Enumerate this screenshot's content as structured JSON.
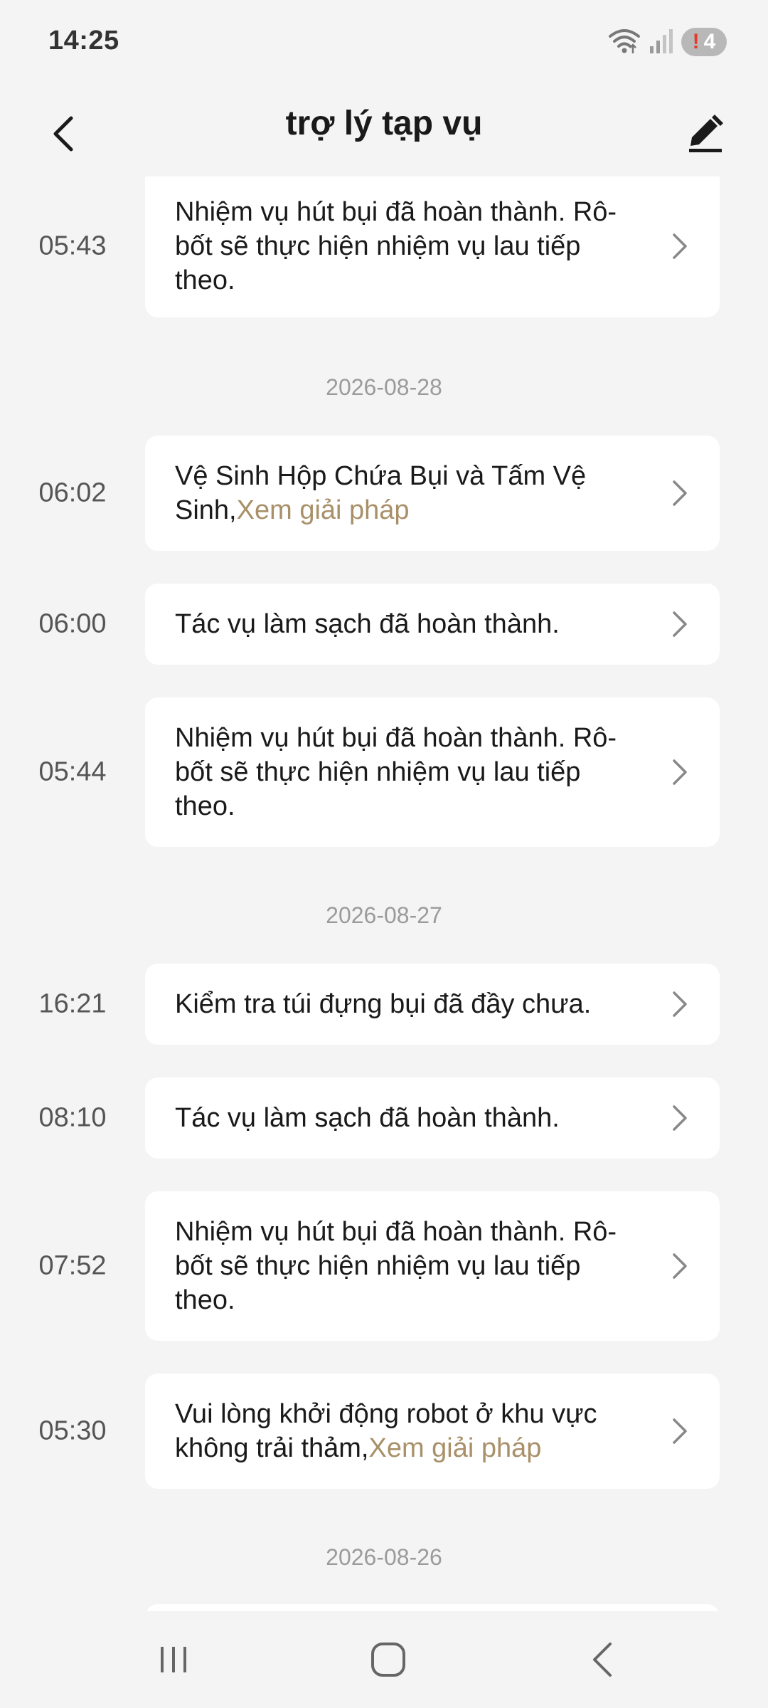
{
  "status_bar": {
    "time": "14:25",
    "icons": [
      "wifi-icon",
      "signal-icon"
    ],
    "badge_excl": "!",
    "badge_count": "4"
  },
  "header": {
    "title": "trợ lý tạp vụ",
    "back_icon": "back-arrow-icon",
    "edit_icon": "edit-icon"
  },
  "entries": [
    {
      "time": "05:43",
      "text": "Nhiệm vụ hút bụi đã hoàn thành. Rô-bốt sẽ thực hiện nhiệm vụ lau tiếp theo.",
      "link": ""
    },
    {
      "date": "2026-08-28"
    },
    {
      "time": "06:02",
      "text": "Vệ Sinh Hộp Chứa Bụi và Tấm Vệ Sinh,",
      "link": "Xem giải pháp"
    },
    {
      "time": "06:00",
      "text": "Tác vụ làm sạch đã hoàn thành.",
      "link": ""
    },
    {
      "time": "05:44",
      "text": "Nhiệm vụ hút bụi đã hoàn thành. Rô-bốt sẽ thực hiện nhiệm vụ lau tiếp theo.",
      "link": ""
    },
    {
      "date": "2026-08-27"
    },
    {
      "time": "16:21",
      "text": "Kiểm tra túi đựng bụi đã đầy chưa.",
      "link": ""
    },
    {
      "time": "08:10",
      "text": "Tác vụ làm sạch đã hoàn thành.",
      "link": ""
    },
    {
      "time": "07:52",
      "text": "Nhiệm vụ hút bụi đã hoàn thành. Rô-bốt sẽ thực hiện nhiệm vụ lau tiếp theo.",
      "link": ""
    },
    {
      "time": "05:30",
      "text": "Vui lòng khởi động robot ở khu vực không trải thảm,",
      "link": "Xem giải pháp"
    },
    {
      "date": "2026-08-26"
    }
  ],
  "colors": {
    "background": "#f4f4f4",
    "card": "#ffffff",
    "link": "#a89068",
    "date": "#9b9b9b"
  },
  "nav_bar": {
    "icons": [
      "recent-apps-icon",
      "home-icon",
      "back-icon"
    ]
  }
}
